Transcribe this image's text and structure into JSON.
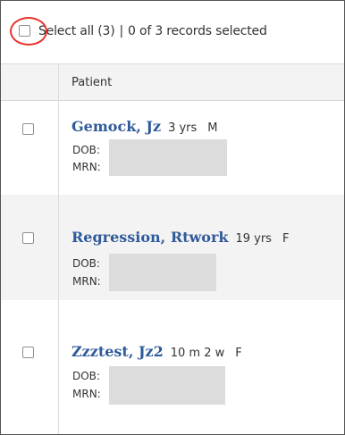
{
  "select_all": {
    "label": "Select all (3)",
    "separator": "|",
    "status": "0 of 3 records selected"
  },
  "table": {
    "column_header": "Patient"
  },
  "patients": [
    {
      "name": "Gemock, Jz",
      "age": "3 yrs",
      "sex": "M",
      "dob_label": "DOB:",
      "mrn_label": "MRN:"
    },
    {
      "name": "Regression, Rtwork",
      "age": "19 yrs",
      "sex": "F",
      "dob_label": "DOB:",
      "mrn_label": "MRN:"
    },
    {
      "name": "Zzztest, Jz2",
      "age": "10 m 2 w",
      "sex": "F",
      "dob_label": "DOB:",
      "mrn_label": "MRN:"
    }
  ]
}
